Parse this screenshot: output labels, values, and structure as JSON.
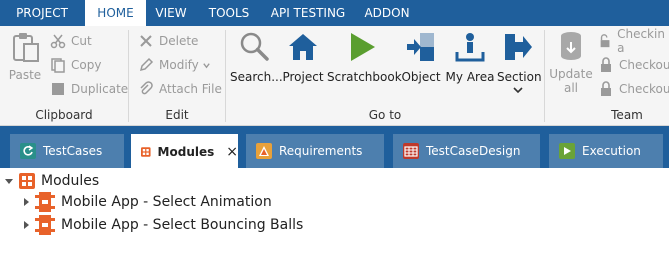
{
  "menu": {
    "tabs": [
      {
        "label": "PROJECT"
      },
      {
        "label": "HOME"
      },
      {
        "label": "VIEW"
      },
      {
        "label": "TOOLS"
      },
      {
        "label": "API TESTING"
      },
      {
        "label": "ADDON"
      }
    ],
    "active_tab": "HOME"
  },
  "ribbon": {
    "clipboard": {
      "paste": "Paste",
      "cut": "Cut",
      "copy": "Copy",
      "duplicate": "Duplicate",
      "group_label": "Clipboard"
    },
    "edit": {
      "delete": "Delete",
      "modify": "Modify",
      "attach_file": "Attach File",
      "group_label": "Edit"
    },
    "goto": {
      "search": "Search...",
      "project": "Project",
      "scratchbook": "Scratchbook",
      "object": "Object",
      "my_area": "My Area",
      "section": "Section",
      "group_label": "Go to"
    },
    "team": {
      "update_line1": "Update",
      "update_line2": "all",
      "checkin": "Checkin a",
      "checkout1": "Checkout",
      "checkout2": "Checkout",
      "group_label": "Team"
    }
  },
  "doc_tabs": [
    {
      "label": "TestCases",
      "icon": "testcases-icon",
      "color": "#2a8f8a"
    },
    {
      "label": "Modules",
      "icon": "modules-icon",
      "color": "#e8622a",
      "close": "×"
    },
    {
      "label": "Requirements",
      "icon": "requirements-icon",
      "color": "#e8a13a"
    },
    {
      "label": "TestCaseDesign",
      "icon": "testcasedesign-icon",
      "color": "#c0392b"
    },
    {
      "label": "Execution",
      "icon": "execution-icon",
      "color": "#6aa338"
    }
  ],
  "tree": {
    "root": "Modules",
    "children": [
      {
        "label": "Mobile App - Select Animation"
      },
      {
        "label": "Mobile App - Select Bouncing Balls"
      }
    ]
  },
  "colors": {
    "brand_blue": "#1f5f9c",
    "tab_blue": "#4d7fae",
    "module_orange": "#e8622a"
  }
}
